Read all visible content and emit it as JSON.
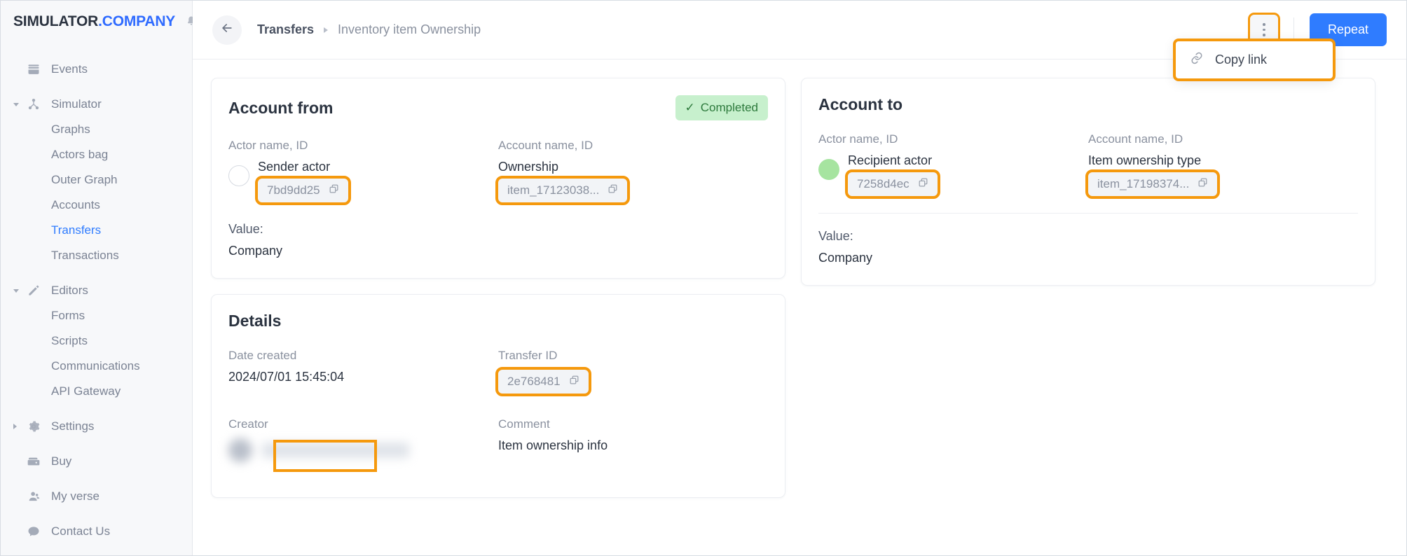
{
  "brand": {
    "name_primary": "SIMULATOR",
    "name_secondary": ".COMPANY",
    "bell_icon": "bell-icon"
  },
  "sidebar": {
    "items": [
      {
        "label": "Events",
        "icon": "events-icon",
        "level": "top",
        "caret": "none",
        "active": false
      },
      {
        "label": "Simulator",
        "icon": "simulator-icon",
        "level": "top",
        "caret": "open",
        "active": false
      },
      {
        "label": "Graphs",
        "icon": "",
        "level": "child",
        "caret": "none",
        "active": false
      },
      {
        "label": "Actors bag",
        "icon": "",
        "level": "child",
        "caret": "none",
        "active": false
      },
      {
        "label": "Outer Graph",
        "icon": "",
        "level": "child",
        "caret": "none",
        "active": false
      },
      {
        "label": "Accounts",
        "icon": "",
        "level": "child",
        "caret": "none",
        "active": false
      },
      {
        "label": "Transfers",
        "icon": "",
        "level": "child",
        "caret": "none",
        "active": true
      },
      {
        "label": "Transactions",
        "icon": "",
        "level": "child",
        "caret": "none",
        "active": false
      },
      {
        "label": "Editors",
        "icon": "pencil-icon",
        "level": "top",
        "caret": "open",
        "active": false
      },
      {
        "label": "Forms",
        "icon": "",
        "level": "child",
        "caret": "none",
        "active": false
      },
      {
        "label": "Scripts",
        "icon": "",
        "level": "child",
        "caret": "none",
        "active": false
      },
      {
        "label": "Communications",
        "icon": "",
        "level": "child",
        "caret": "none",
        "active": false
      },
      {
        "label": "API Gateway",
        "icon": "",
        "level": "child",
        "caret": "none",
        "active": false
      },
      {
        "label": "Settings",
        "icon": "gear-icon",
        "level": "top",
        "caret": "closed",
        "active": false
      },
      {
        "label": "Buy",
        "icon": "wallet-icon",
        "level": "top",
        "caret": "none",
        "active": false
      },
      {
        "label": "My verse",
        "icon": "user-icon",
        "level": "top",
        "caret": "none",
        "active": false
      },
      {
        "label": "Contact Us",
        "icon": "chat-icon",
        "level": "top",
        "caret": "none",
        "active": false
      }
    ]
  },
  "topbar": {
    "back_icon": "arrow-left-icon",
    "breadcrumb": {
      "parent": "Transfers",
      "separator": "▶",
      "current": "Inventory item Ownership"
    },
    "kebab_icon": "more-vertical-icon",
    "repeat_label": "Repeat",
    "menu": {
      "items": [
        {
          "label": "Copy link",
          "icon": "link-icon"
        }
      ]
    }
  },
  "account_from": {
    "title": "Account from",
    "status_badge": {
      "label": "Completed",
      "check": "✓"
    },
    "actor": {
      "label": "Actor name, ID",
      "name": "Sender actor",
      "id": "7bd9dd25",
      "copy_icon": "copy-icon",
      "avatar": "empty"
    },
    "account": {
      "label": "Account name, ID",
      "name": "Ownership",
      "id": "item_17123038...",
      "copy_icon": "copy-icon"
    },
    "value": {
      "label": "Value:",
      "text": "Company"
    }
  },
  "account_to": {
    "title": "Account to",
    "actor": {
      "label": "Actor name, ID",
      "name": "Recipient actor",
      "id": "7258d4ec",
      "copy_icon": "copy-icon",
      "avatar": "green"
    },
    "account": {
      "label": "Account name, ID",
      "name": "Item ownership type",
      "id": "item_17198374...",
      "copy_icon": "copy-icon"
    },
    "value": {
      "label": "Value:",
      "text": "Company"
    }
  },
  "details": {
    "title": "Details",
    "date_created": {
      "label": "Date created",
      "value": "2024/07/01 15:45:04"
    },
    "transfer_id": {
      "label": "Transfer ID",
      "value": "2e768481",
      "copy_icon": "copy-icon"
    },
    "creator": {
      "label": "Creator",
      "value": ""
    },
    "comment": {
      "label": "Comment",
      "value": "Item ownership info"
    }
  },
  "colors": {
    "accent_blue": "#2f7cff",
    "highlight_orange": "#f5990d",
    "badge_green_bg": "#c7f0cd",
    "badge_green_text": "#2d7a3c",
    "avatar_green": "#a6e4a0"
  }
}
